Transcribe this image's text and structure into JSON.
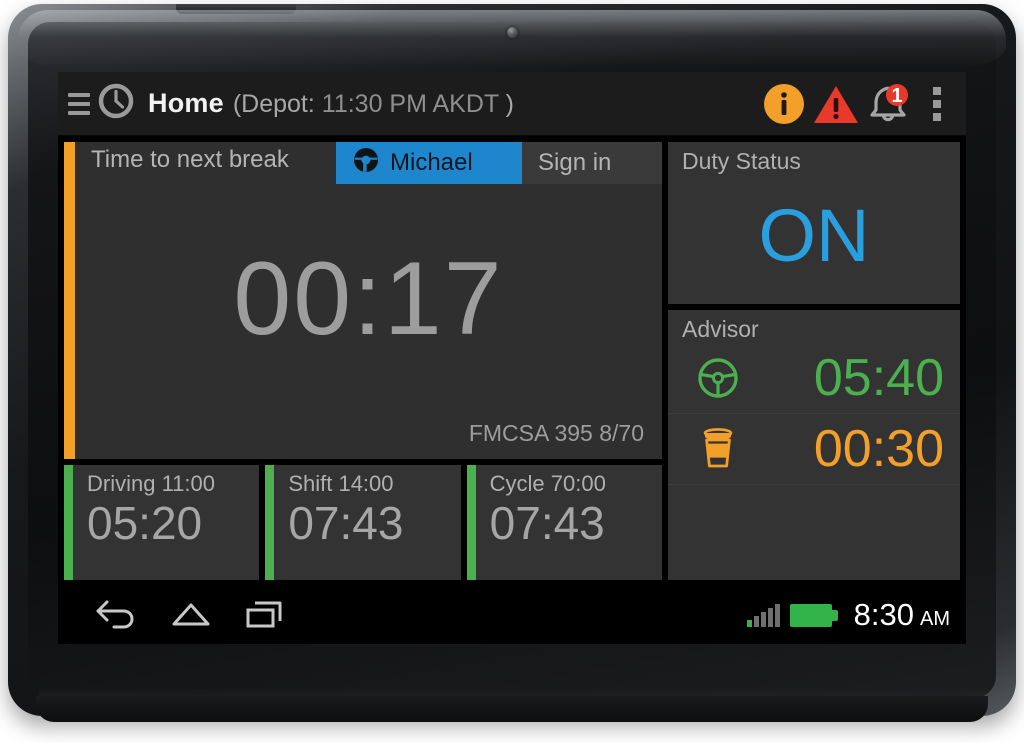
{
  "app": {
    "action_bar": {
      "menu_icon": "hamburger-menu-icon",
      "clock_icon": "clock-icon",
      "title": "Home",
      "subtitle_prefix": "(Depot:",
      "subtitle_time": "11:30 PM AKDT",
      "subtitle_suffix": ")",
      "info_icon": "info-icon",
      "warning_icon": "warning-triangle-icon",
      "notification_icon": "notification-bell-icon",
      "notification_count": "1",
      "overflow_icon": "overflow-menu-icon"
    },
    "break_panel": {
      "label": "Time to next break",
      "driver_tab": {
        "icon": "steering-wheel-icon",
        "name": "Michael"
      },
      "signin_tab": "Sign in",
      "timer": "00:17",
      "ruleset": "FMCSA 395 8/70",
      "accent_color": "#f2a02a"
    },
    "metrics": [
      {
        "title": "Driving 11:00",
        "value": "05:20",
        "accent": "#4caf50"
      },
      {
        "title": "Shift 14:00",
        "value": "07:43",
        "accent": "#4caf50"
      },
      {
        "title": "Cycle 70:00",
        "value": "07:43",
        "accent": "#4caf50"
      }
    ],
    "duty_status": {
      "heading": "Duty Status",
      "value": "ON",
      "value_color": "#2a9fe0"
    },
    "advisor": {
      "heading": "Advisor",
      "rows": [
        {
          "icon": "steering-wheel-icon",
          "value": "05:40",
          "color": "#4caf50"
        },
        {
          "icon": "coffee-cup-icon",
          "value": "00:30",
          "color": "#f2a02a"
        }
      ]
    },
    "system_bar": {
      "back_icon": "back-arrow-icon",
      "home_icon": "home-icon",
      "recents_icon": "recent-apps-icon",
      "signal_icon": "cellular-signal-icon",
      "battery_icon": "battery-full-icon",
      "clock_time": "8:30",
      "clock_ampm": "AM"
    }
  }
}
